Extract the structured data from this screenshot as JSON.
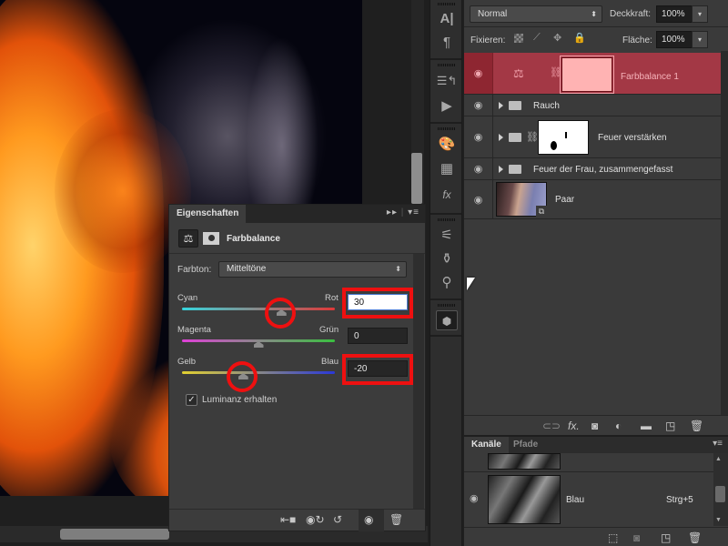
{
  "properties_panel": {
    "tab_label": "Eigenschaften",
    "collapse_icon": "double-chevron-right-icon",
    "menu_icon": "panel-menu-icon",
    "adjustment_title": "Farbbalance",
    "tone_label": "Farbton:",
    "tone_value": "Mitteltöne",
    "sliders": [
      {
        "left": "Cyan",
        "right": "Rot",
        "value": "30",
        "min": -100,
        "max": 100,
        "active": true,
        "highlighted": true
      },
      {
        "left": "Magenta",
        "right": "Grün",
        "value": "0",
        "min": -100,
        "max": 100,
        "active": false,
        "highlighted": false
      },
      {
        "left": "Gelb",
        "right": "Blau",
        "value": "-20",
        "min": -100,
        "max": 100,
        "active": false,
        "highlighted": true
      }
    ],
    "preserve_luminosity_label": "Luminanz erhalten",
    "preserve_luminosity_checked": true,
    "footer_icons": [
      "clip-to-layer-icon",
      "view-previous-state-icon",
      "reset-icon",
      "visibility-icon",
      "delete-icon"
    ]
  },
  "layers_panel": {
    "blend_mode": "Normal",
    "opacity_label": "Deckkraft:",
    "opacity_value": "100%",
    "lock_label": "Fixieren:",
    "fill_label": "Fläche:",
    "fill_value": "100%",
    "layers": [
      {
        "name": "Farbbalance 1",
        "type": "adjustment",
        "selected": true,
        "visible": true
      },
      {
        "name": "Rauch",
        "type": "group",
        "selected": false,
        "visible": true
      },
      {
        "name": "Feuer verstärken",
        "type": "group-masked",
        "selected": false,
        "visible": true
      },
      {
        "name": "Feuer der Frau, zusammengefasst",
        "type": "group",
        "selected": false,
        "visible": true
      },
      {
        "name": "Paar",
        "type": "smart-object",
        "selected": false,
        "visible": true
      }
    ],
    "footer_icons": [
      "link-icon",
      "fx-icon",
      "add-mask-icon",
      "adjustment-layer-icon",
      "new-group-icon",
      "new-layer-icon",
      "delete-icon"
    ]
  },
  "channels_panel": {
    "tabs": [
      {
        "label": "Kanäle",
        "active": true
      },
      {
        "label": "Pfade",
        "active": false
      }
    ],
    "channels": [
      {
        "name": "Blau",
        "shortcut": "Strg+5",
        "visible": true
      }
    ],
    "footer_icons": [
      "load-selection-icon",
      "save-selection-icon",
      "new-channel-icon",
      "delete-icon"
    ]
  },
  "toolstrip": {
    "groups": [
      [
        "character-icon",
        "paragraph-icon"
      ],
      [
        "history-icon",
        "actions-icon"
      ],
      [
        "color-icon",
        "swatches-icon",
        "styles-icon"
      ],
      [
        "brush-presets-icon",
        "brushes-icon",
        "clone-source-icon"
      ],
      [
        "properties-icon"
      ]
    ]
  }
}
